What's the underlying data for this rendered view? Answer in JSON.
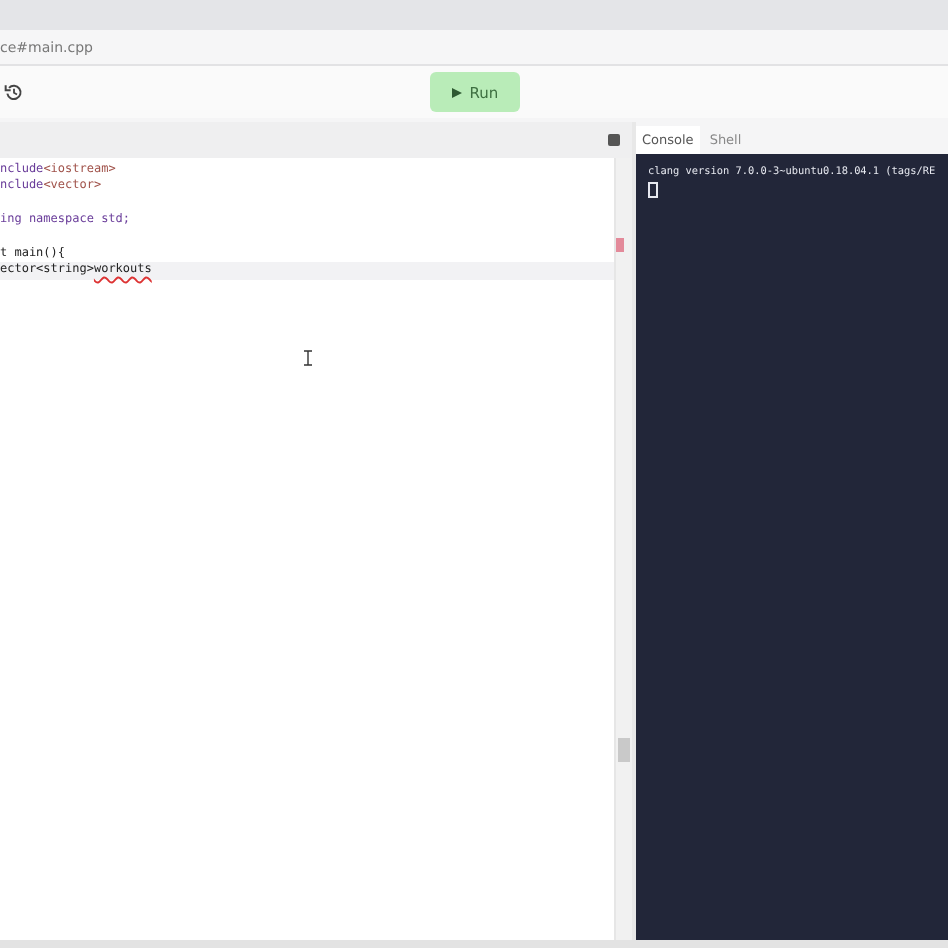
{
  "address_bar": {
    "text": "ce#main.cpp"
  },
  "toolbar": {
    "run_button": "Run"
  },
  "editor": {
    "lines": [
      {
        "active": false,
        "tokens": [
          {
            "text": "nclude",
            "kind": "keyword"
          },
          {
            "text": "<iostream>",
            "kind": "string"
          }
        ]
      },
      {
        "active": false,
        "tokens": [
          {
            "text": "nclude",
            "kind": "keyword"
          },
          {
            "text": "<vector>",
            "kind": "string"
          }
        ]
      },
      {
        "active": false
      },
      {
        "active": false,
        "tokens": [
          {
            "text": "ing namespace std;",
            "kind": "keyword"
          }
        ]
      },
      {
        "active": false
      },
      {
        "active": false,
        "tokens": [
          {
            "text": "t main(){",
            "kind": "plain"
          }
        ]
      },
      {
        "active": true,
        "tokens": [
          {
            "text": "ector<string>",
            "kind": "plain"
          },
          {
            "text": "workouts",
            "kind": "error"
          }
        ]
      }
    ]
  },
  "console": {
    "tabs": [
      {
        "label": "Console",
        "selected": true
      },
      {
        "label": "Shell",
        "selected": false
      }
    ],
    "output": "clang version 7.0.0-3~ubuntu0.18.04.1 (tags/RE"
  }
}
